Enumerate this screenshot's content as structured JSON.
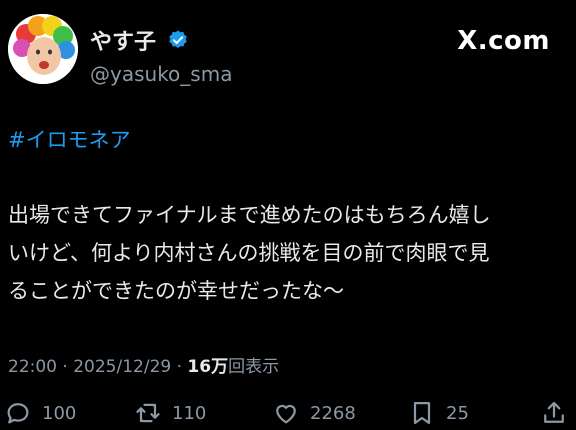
{
  "author": {
    "display_name": "やす子",
    "handle": "@yasuko_sma"
  },
  "brand": "X.com",
  "post": {
    "hashtag": "#イロモネア",
    "lines": [
      "出場できてファイナルまで進めたのはもちろん嬉し",
      "いけど、何より内村さんの挑戦を目の前で肉眼で見",
      "ることができたのが幸せだったな〜"
    ],
    "time": "22:00",
    "date": "2025/12/29",
    "views_count": "16万",
    "views_label": "回表示"
  },
  "actions": {
    "replies": "100",
    "reposts": "110",
    "likes": "2268",
    "bookmarks": "25"
  },
  "colors": {
    "background": "#000000",
    "link": "#1d9bf0",
    "muted": "#8b98a5",
    "verified": "#1d9bf0"
  },
  "icons": [
    "verified-badge-icon",
    "reply-icon",
    "repost-icon",
    "like-icon",
    "bookmark-icon",
    "share-icon"
  ]
}
